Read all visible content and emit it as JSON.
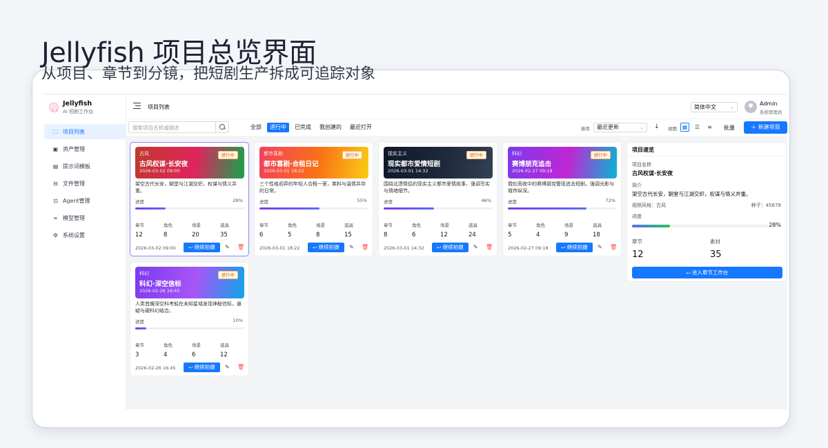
{
  "hero": {
    "title": "Jellyfish 项目总览界面",
    "subtitle": "从项目、章节到分镜，把短剧生产拆成可追踪对象"
  },
  "brand": {
    "name": "Jellyfish",
    "sub": "AI 短剧工作台"
  },
  "sidebar": {
    "items": [
      {
        "label": "项目列表",
        "icon": "folder-icon",
        "active": true
      },
      {
        "label": "资产管理",
        "icon": "image-icon"
      },
      {
        "label": "提示词模板",
        "icon": "file-icon"
      },
      {
        "label": "文件管理",
        "icon": "archive-icon"
      },
      {
        "label": "Agent管理",
        "icon": "robot-icon"
      },
      {
        "label": "模型管理",
        "icon": "link-icon"
      },
      {
        "label": "系统设置",
        "icon": "gear-icon"
      }
    ]
  },
  "topbar": {
    "page_title": "项目列表",
    "language": "简体中文",
    "user_name": "Admin",
    "user_role": "系统管理员"
  },
  "toolbar": {
    "search_placeholder": "搜索项目名称或描述",
    "filters": [
      "全部",
      "进行中",
      "已完成",
      "我创建的",
      "最近打开"
    ],
    "active_filter": "进行中",
    "sort_label": "排序",
    "sort_value": "最近更新",
    "view_label": "视图",
    "batch_label": "批量",
    "new_label": "＋ 新建项目"
  },
  "card_labels": {
    "progress": "进度",
    "chapters": "章节",
    "roles": "角色",
    "scenes": "场景",
    "props": "道具",
    "continue": "⮠ 继续拍摄"
  },
  "projects": [
    {
      "genre": "古风",
      "title": "古风权谋·长安夜",
      "date": "2026-03-02 09:00",
      "status": "进行中",
      "desc": "架空古代长安，朝堂与江湖交织，权谋与情义并重。",
      "progress": 28,
      "progress_text": "28%",
      "chapters": "12",
      "roles": "8",
      "scenes": "20",
      "props": "35",
      "gradient": [
        "#c0392b",
        "#e0245e",
        "#16a34a"
      ]
    },
    {
      "genre": "都市喜剧",
      "title": "都市喜剧·合租日记",
      "date": "2026-03-01 18:22",
      "status": "进行中",
      "desc": "三个性格迥异的年轻人合租一室，笑料与温情并存的日常。",
      "progress": 55,
      "progress_text": "55%",
      "chapters": "6",
      "roles": "5",
      "scenes": "8",
      "props": "15",
      "gradient": [
        "#f43f5e",
        "#f97316",
        "#facc15"
      ]
    },
    {
      "genre": "现实主义",
      "title": "现实都市爱情短剧",
      "date": "2026-03-01 14:32",
      "status": "进行中",
      "desc": "围绕北漂情侣的现实主义都市爱情故事，强调写实与情绪细节。",
      "progress": 46,
      "progress_text": "46%",
      "chapters": "8",
      "roles": "6",
      "scenes": "12",
      "props": "24",
      "gradient": [
        "#0f172a",
        "#1e293b",
        "#334155"
      ]
    },
    {
      "genre": "科幻",
      "title": "赛博朋克追击",
      "date": "2026-02-27 09:18",
      "status": "进行中",
      "desc": "霓虹雨夜中的赛博朋克警匪追击短剧，强调光影与城市纵深。",
      "progress": 72,
      "progress_text": "72%",
      "chapters": "5",
      "roles": "4",
      "scenes": "9",
      "props": "18",
      "gradient": [
        "#7c3aed",
        "#c026d3",
        "#06b6d4"
      ]
    },
    {
      "genre": "科幻",
      "title": "科幻·深空信标",
      "date": "2026-02-26 16:45",
      "status": "进行中",
      "desc": "人类首艘深空科考船在未知星域发现神秘信标，悬疑与硬科幻结合。",
      "progress": 10,
      "progress_text": "10%",
      "chapters": "3",
      "roles": "4",
      "scenes": "6",
      "props": "12",
      "gradient": [
        "#7c3aed",
        "#a855f7",
        "#0ea5e9"
      ]
    }
  ],
  "panel": {
    "title": "项目速览",
    "name_label": "项目名称",
    "name": "古风权谋·长安夜",
    "intro_label": "简介",
    "intro": "架空古代长安，朝堂与江湖交织，权谋与情义并重。",
    "style": "视频风格：古风",
    "seed": "种子：45678",
    "progress_label": "进度",
    "progress": 28,
    "progress_text": "28%",
    "chapters_label": "章节",
    "chapters": "12",
    "assets_label": "素材",
    "assets": "35",
    "enter_label": "⮠ 进入章节工作台"
  },
  "colors": {
    "accent": "#1677ff",
    "danger": "#ff4d4f",
    "badge": "#d46b08"
  }
}
